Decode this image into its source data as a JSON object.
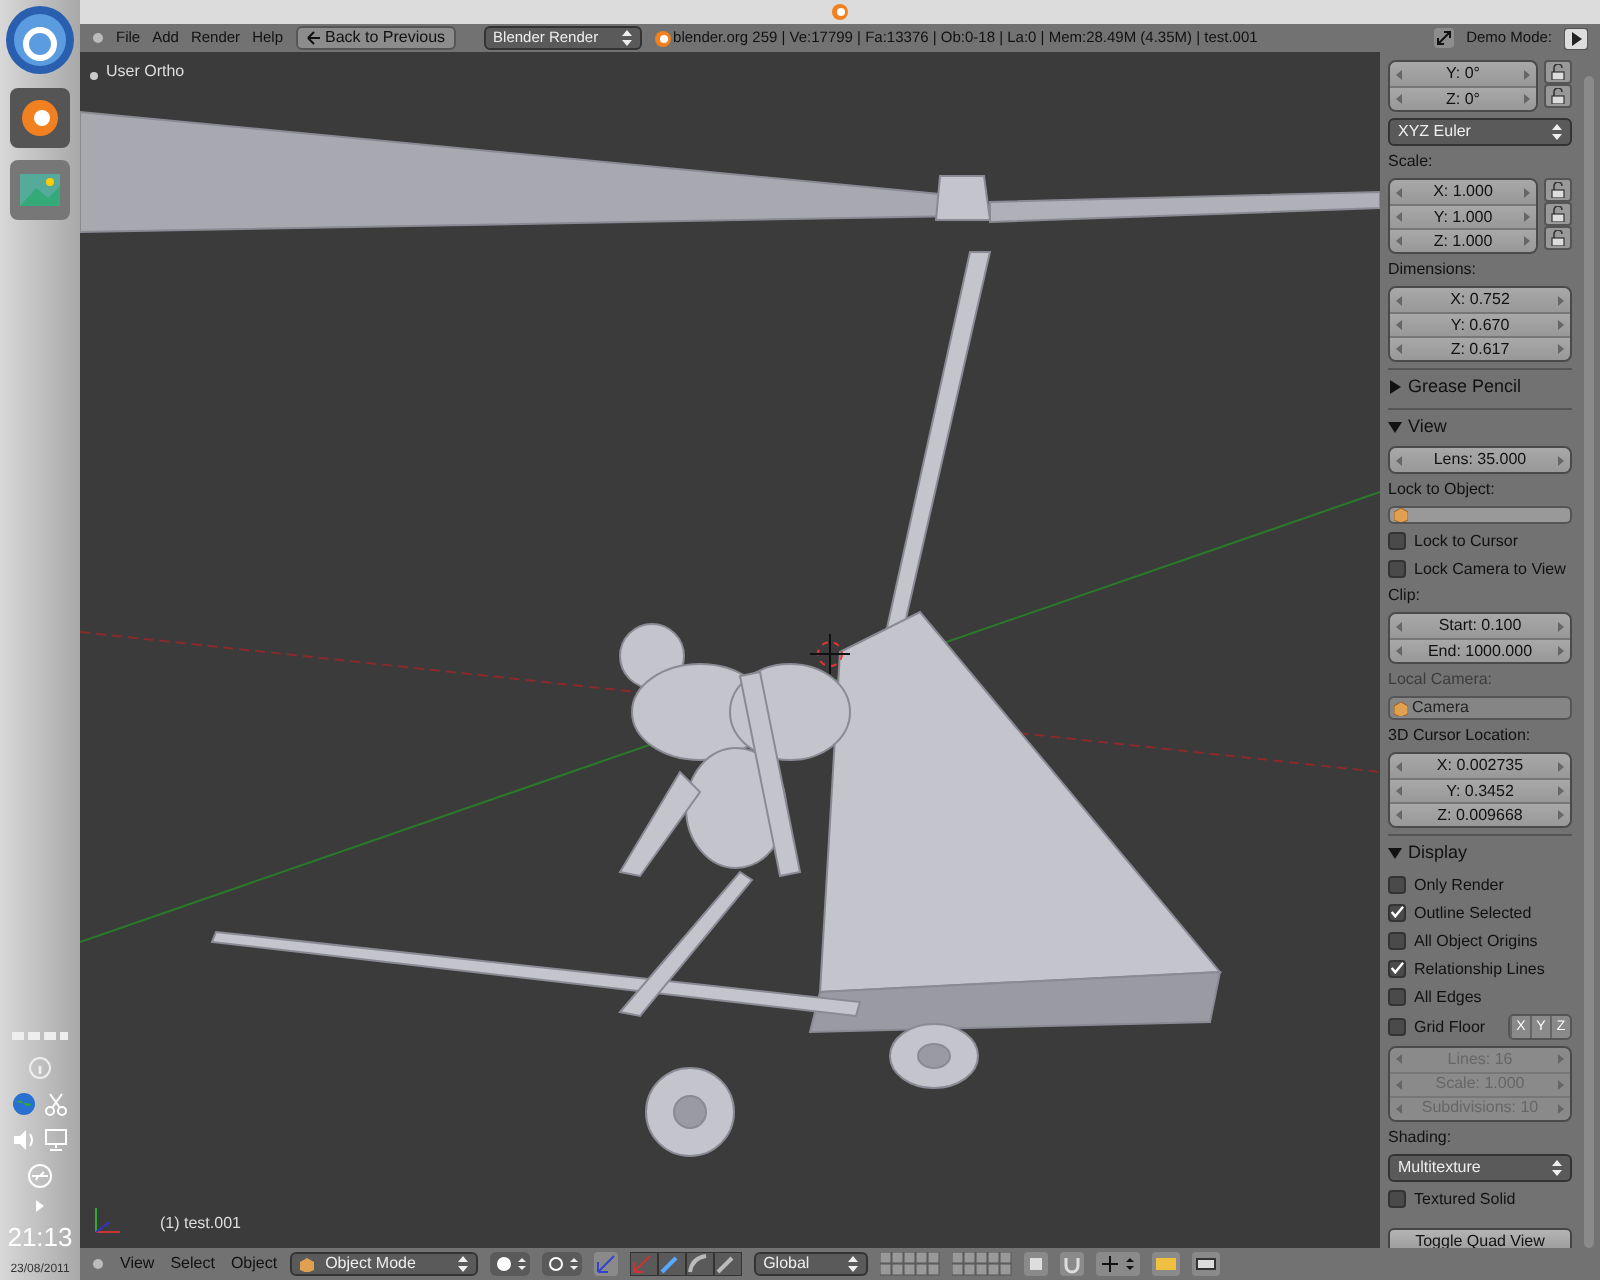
{
  "header": {
    "menus": [
      "File",
      "Add",
      "Render",
      "Help"
    ],
    "back_button": "Back to Previous",
    "render_engine": "Blender Render",
    "stats": "blender.org 259 | Ve:17799 | Fa:13376 | Ob:0-18 | La:0 | Mem:28.49M (4.35M) | test.001",
    "demo_mode_label": "Demo Mode:"
  },
  "viewport": {
    "view_label": "User Ortho",
    "object_label": "(1) test.001"
  },
  "panel": {
    "rows": [
      {
        "kind": "vector",
        "fields": [
          "Y: 0°",
          "Z: 0°"
        ],
        "locks": true,
        "disabled": false
      },
      {
        "kind": "dropdown",
        "value": "XYZ Euler"
      },
      {
        "kind": "label",
        "text": "Scale:",
        "disabled": false
      },
      {
        "kind": "vector",
        "fields": [
          "X: 1.000",
          "Y: 1.000",
          "Z: 1.000"
        ],
        "locks": true,
        "disabled": false
      },
      {
        "kind": "label",
        "text": "Dimensions:",
        "disabled": false
      },
      {
        "kind": "vector",
        "fields": [
          "X: 0.752",
          "Y: 0.670",
          "Z: 0.617"
        ],
        "locks": false,
        "disabled": false
      },
      {
        "kind": "section",
        "title": "Grease Pencil",
        "expanded": false
      },
      {
        "kind": "section",
        "title": "View",
        "expanded": true
      },
      {
        "kind": "vector",
        "fields": [
          "Lens: 35.000"
        ],
        "locks": false,
        "disabled": false
      },
      {
        "kind": "label",
        "text": "Lock to Object:",
        "disabled": false
      },
      {
        "kind": "object_field",
        "disabled": false
      },
      {
        "kind": "checkbox",
        "label": "Lock to Cursor",
        "checked": false
      },
      {
        "kind": "checkbox",
        "label": "Lock Camera to View",
        "checked": false
      },
      {
        "kind": "label",
        "text": "Clip:",
        "disabled": false
      },
      {
        "kind": "vector",
        "fields": [
          "Start: 0.100",
          "End: 1000.000"
        ],
        "locks": false,
        "disabled": false
      },
      {
        "kind": "label",
        "text": "Local Camera:",
        "disabled": true
      },
      {
        "kind": "object_field",
        "value": "Camera",
        "disabled": true
      },
      {
        "kind": "label",
        "text": "3D Cursor Location:",
        "disabled": false
      },
      {
        "kind": "vector",
        "fields": [
          "X: 0.002735",
          "Y: 0.3452",
          "Z: 0.009668"
        ],
        "locks": false,
        "disabled": false
      },
      {
        "kind": "section",
        "title": "Display",
        "expanded": true
      },
      {
        "kind": "checkbox",
        "label": "Only Render",
        "checked": false
      },
      {
        "kind": "checkbox",
        "label": "Outline Selected",
        "checked": true
      },
      {
        "kind": "checkbox",
        "label": "All Object Origins",
        "checked": false
      },
      {
        "kind": "checkbox",
        "label": "Relationship Lines",
        "checked": true
      },
      {
        "kind": "checkbox",
        "label": "All Edges",
        "checked": false
      },
      {
        "kind": "checkbox",
        "label": "Grid Floor",
        "checked": false,
        "axes": [
          {
            "label": "X",
            "selected": false
          },
          {
            "label": "Y",
            "selected": false
          },
          {
            "label": "Z",
            "selected": false
          }
        ]
      },
      {
        "kind": "vector",
        "fields": [
          "Lines: 16",
          "Scale: 1.000",
          "Subdivisions: 10"
        ],
        "locks": false,
        "disabled": true
      },
      {
        "kind": "label",
        "text": "Shading:",
        "disabled": false
      },
      {
        "kind": "dropdown",
        "value": "Multitexture"
      },
      {
        "kind": "checkbox",
        "label": "Textured Solid",
        "checked": false
      },
      {
        "kind": "button",
        "label": "Toggle Quad View"
      }
    ]
  },
  "footer": {
    "menus": [
      "View",
      "Select",
      "Object"
    ],
    "mode": "Object Mode",
    "orientation": "Global"
  },
  "dock": {
    "time": "21:13",
    "date": "23/08/2011"
  }
}
